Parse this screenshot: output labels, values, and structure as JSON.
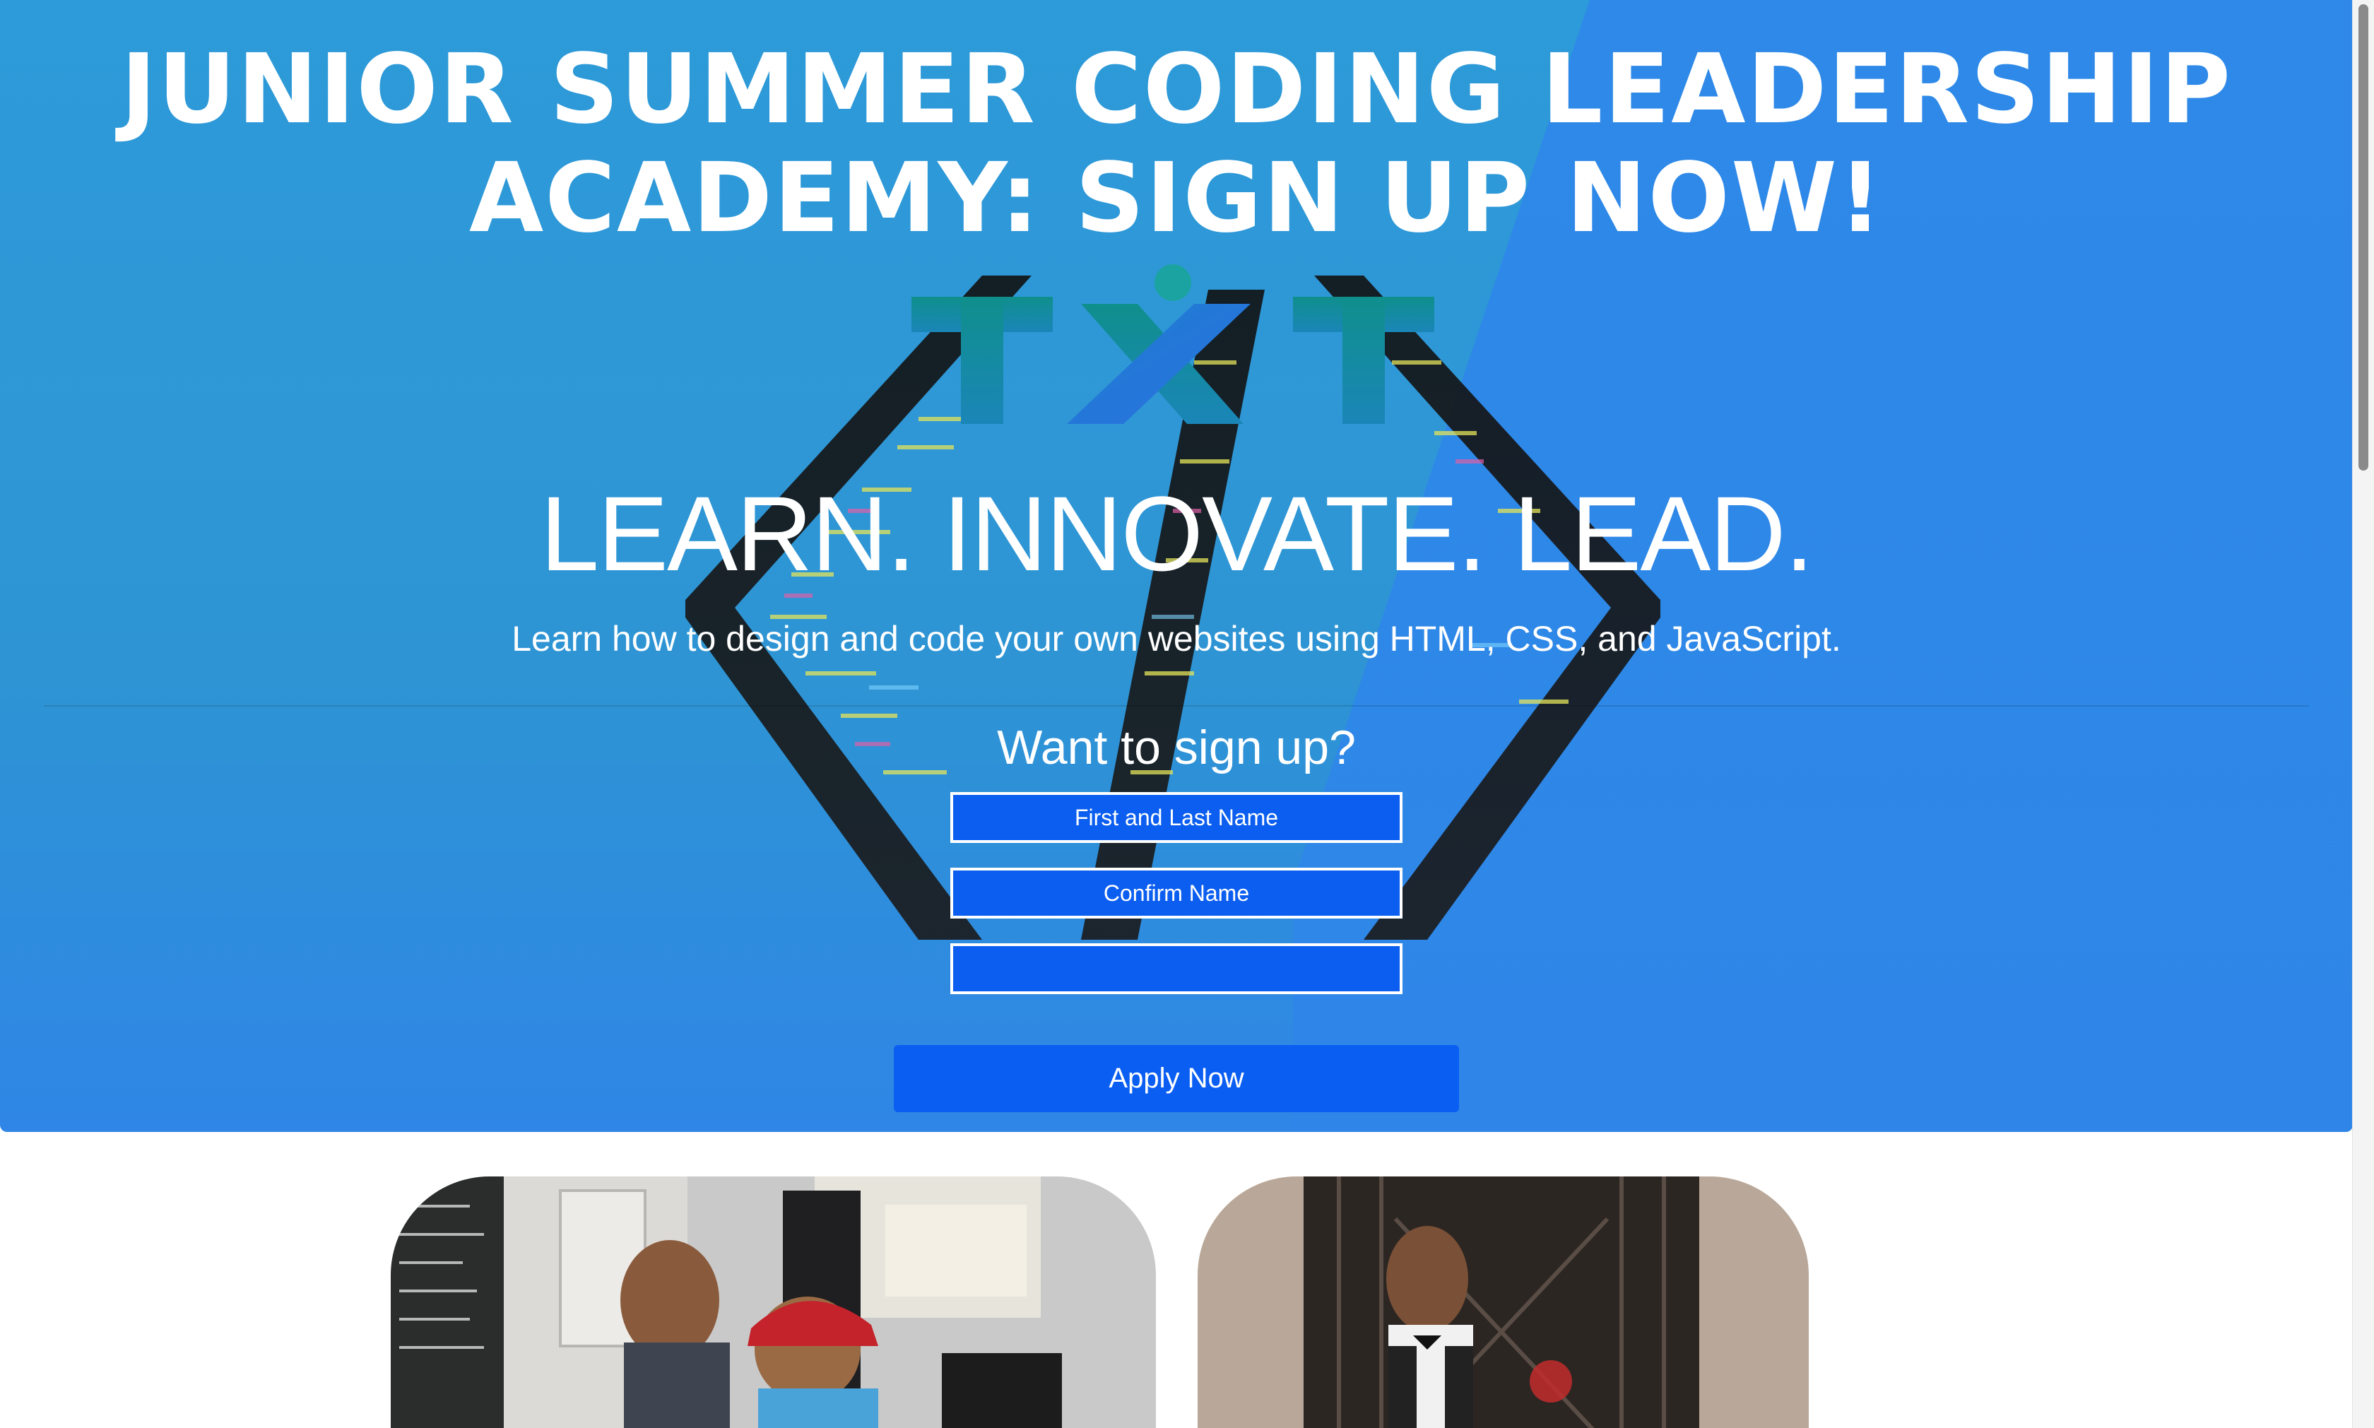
{
  "hero": {
    "title": "JUNIOR SUMMER CODING LEADERSHIP ACADEMY: SIGN UP NOW!",
    "logo_text": "TXT",
    "tagline": "LEARN. INNOVATE. LEAD.",
    "subtitle": "Learn how to design and code your own websites using HTML, CSS, and JavaScript."
  },
  "signup": {
    "heading": "Want to sign up?",
    "fields": [
      {
        "placeholder": "First and Last Name",
        "value": ""
      },
      {
        "placeholder": "Confirm Name",
        "value": ""
      },
      {
        "placeholder": "",
        "value": ""
      }
    ],
    "submit_label": "Apply Now"
  },
  "photos": [
    {
      "name": "students-coding-photo"
    },
    {
      "name": "student-portrait-photo"
    }
  ],
  "colors": {
    "hero_blue": "#2f97d6",
    "hero_right_blue": "#2f86e8",
    "button_blue": "#0a5ef2",
    "logo_teal": "#0c8c8a",
    "text": "#ffffff"
  },
  "icons": {
    "logo": "txt-logo-icon",
    "background": "code-brackets-icon"
  }
}
